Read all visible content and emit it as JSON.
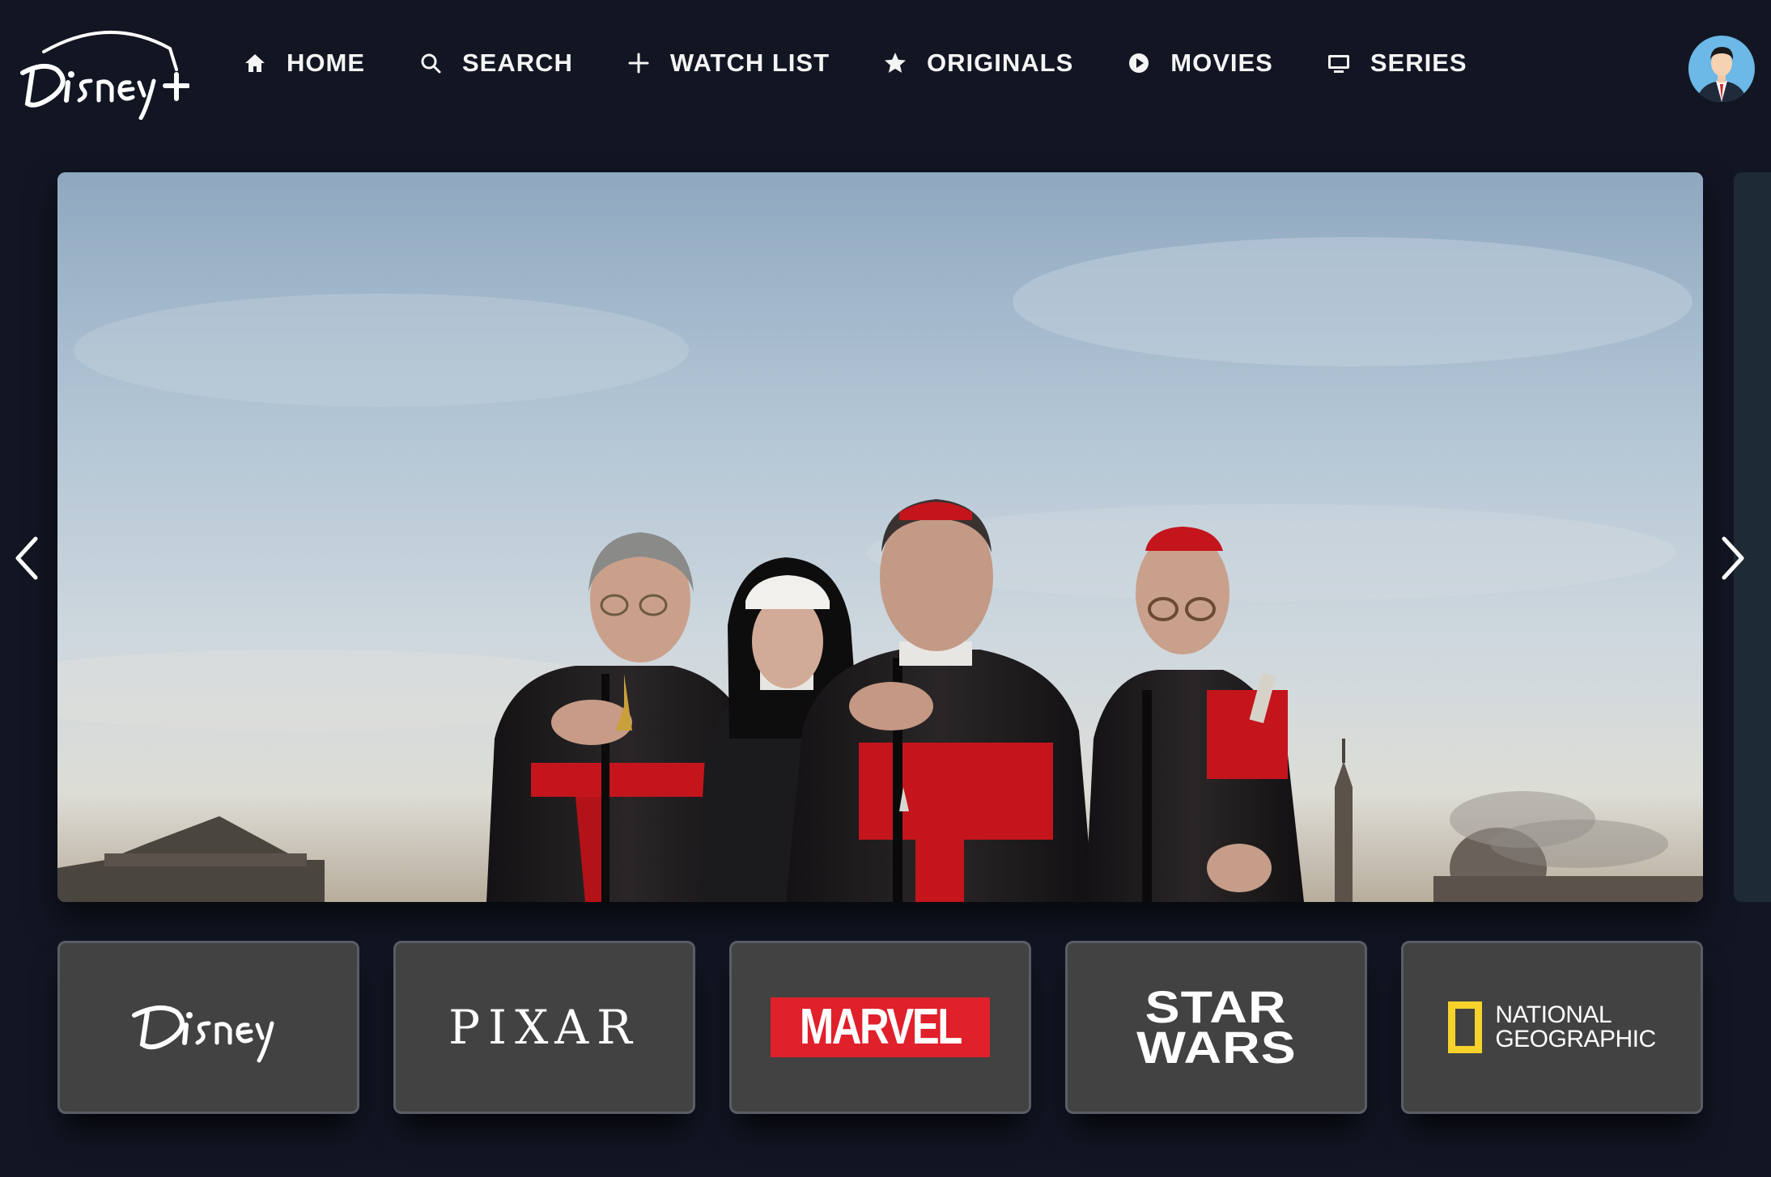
{
  "app": {
    "logo_text": "Disney+",
    "logo_icon": "disney-plus-logo"
  },
  "nav": {
    "items": [
      {
        "label": "HOME",
        "icon": "home-icon"
      },
      {
        "label": "SEARCH",
        "icon": "search-icon"
      },
      {
        "label": "WATCH LIST",
        "icon": "plus-icon"
      },
      {
        "label": "ORIGINALS",
        "icon": "star-icon"
      },
      {
        "label": "MOVIES",
        "icon": "play-circle-icon"
      },
      {
        "label": "SERIES",
        "icon": "tv-icon"
      }
    ]
  },
  "user": {
    "avatar_icon": "user-avatar"
  },
  "carousel": {
    "prev_icon": "chevron-left-icon",
    "next_icon": "chevron-right-icon"
  },
  "brands": {
    "items": [
      {
        "name": "Disney",
        "icon": "disney-logo"
      },
      {
        "name": "PIXAR",
        "icon": "pixar-logo"
      },
      {
        "name": "MARVEL",
        "icon": "marvel-logo"
      },
      {
        "name_line1": "STAR",
        "name_line2": "WARS",
        "icon": "star-wars-logo"
      },
      {
        "name_line1": "NATIONAL",
        "name_line2": "GEOGRAPHIC",
        "icon": "national-geographic-logo"
      }
    ]
  },
  "colors": {
    "background": "#121623",
    "tile_bg": "#424242",
    "tile_border": "#5a5d66",
    "marvel_red": "#e0202b",
    "natgeo_yellow": "#f6d22a",
    "cardinal_red": "#c4151c"
  }
}
